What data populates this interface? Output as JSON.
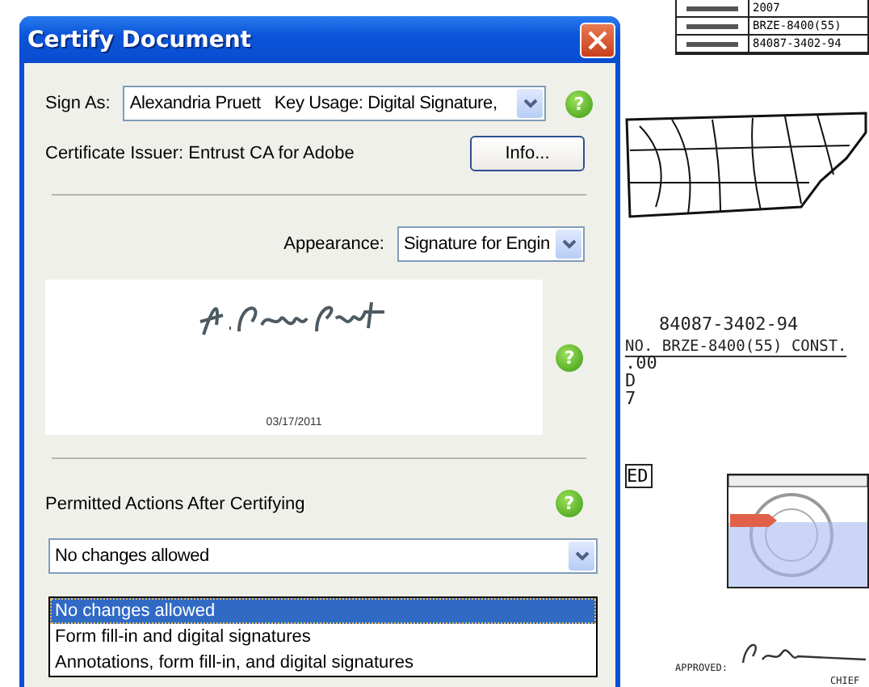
{
  "document": {
    "table_values": [
      "2007",
      "BRZE-8400(55)",
      "84087-3402-94"
    ],
    "project_number": "84087-3402-94",
    "project_line": "NO. BRZE-8400(55) CONST.",
    "fragments": [
      ".00",
      "D",
      "7"
    ],
    "stamp": "ED",
    "approved_label": "APPROVED:",
    "chief_label": "CHIEF"
  },
  "dialog": {
    "title": "Certify Document",
    "sign_as": {
      "label": "Sign As:",
      "value": "Alexandria Pruett   Key Usage: Digital Signature,",
      "help": "?"
    },
    "issuer": "Certificate Issuer: Entrust CA for Adobe",
    "info_button": "Info...",
    "appearance": {
      "label": "Appearance:",
      "value": "Signature for Engin"
    },
    "signature": {
      "date": "03/17/2011",
      "help": "?"
    },
    "permitted": {
      "label": "Permitted Actions After Certifying",
      "help": "?",
      "value": "No changes allowed",
      "expanded": true,
      "options": [
        {
          "label": "No changes allowed",
          "selected": true
        },
        {
          "label": "Form fill-in and digital signatures",
          "selected": false
        },
        {
          "label": "Annotations, form fill-in, and digital signatures",
          "selected": false
        }
      ]
    }
  }
}
